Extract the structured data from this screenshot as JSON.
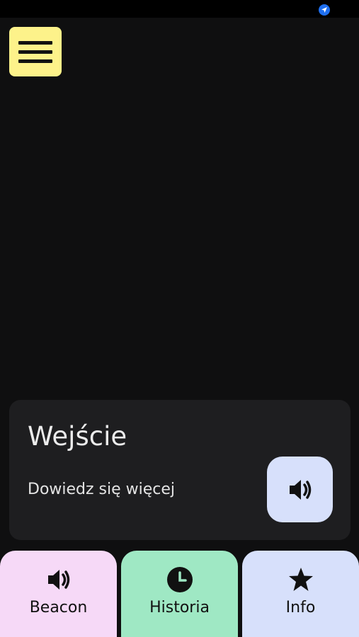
{
  "header": {
    "menu_icon": "hamburger-menu-icon",
    "status_icon": "location-arrow-icon",
    "colors": {
      "menu_button": "#fdf28a",
      "background": "#0f0f10"
    }
  },
  "card": {
    "title": "Wejście",
    "link": "Dowiedz się więcej",
    "speak_icon": "speaker-icon"
  },
  "nav": {
    "tabs": [
      {
        "label": "Beacon",
        "icon": "speaker-icon",
        "color": "#f6d9f7"
      },
      {
        "label": "Historia",
        "icon": "clock-icon",
        "color": "#9fe8c4"
      },
      {
        "label": "Info",
        "icon": "star-icon",
        "color": "#d7e0fb"
      }
    ]
  }
}
